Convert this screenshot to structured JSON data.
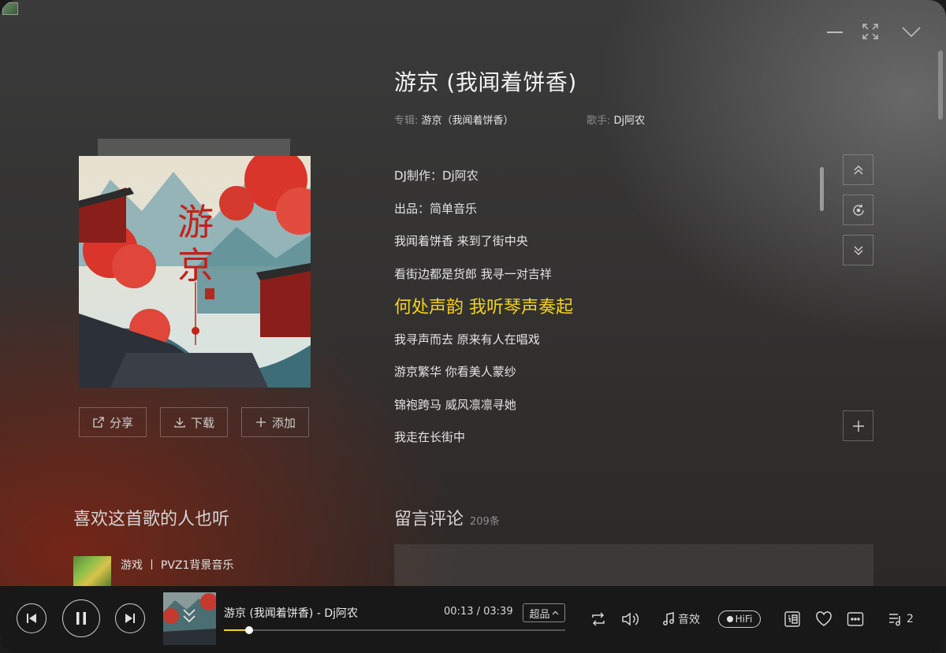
{
  "window": {
    "minimize_icon": "minimize-icon",
    "fullscreen_icon": "fullscreen-icon",
    "collapse_icon": "chevron-down-icon"
  },
  "song": {
    "title": "游京 (我闻着饼香)",
    "album_label": "专辑:",
    "album": "游京（我闻着饼香）",
    "artist_label": "歌手:",
    "artist": "Dj阿农"
  },
  "cover": {
    "title_char_1": "游",
    "title_char_2": "京"
  },
  "actions": {
    "share": "分享",
    "download": "下载",
    "add": "添加"
  },
  "lyrics": [
    {
      "text": "DJ制作：Dj阿农",
      "active": false
    },
    {
      "text": "出品：简单音乐",
      "active": false
    },
    {
      "text": "我闻着饼香 来到了街中央",
      "active": false
    },
    {
      "text": "看街边都是货郎 我寻一对吉祥",
      "active": false
    },
    {
      "text": "何处声韵 我听琴声奏起",
      "active": true
    },
    {
      "text": "我寻声而去 原来有人在唱戏",
      "active": false
    },
    {
      "text": "游京繁华 你看美人蒙纱",
      "active": false
    },
    {
      "text": "锦袍跨马 威风凛凛寻她",
      "active": false
    },
    {
      "text": "我走在长街中",
      "active": false
    }
  ],
  "similar": {
    "title": "喜欢这首歌的人也听",
    "item": "游戏 丨 PVZ1背景音乐"
  },
  "comments": {
    "title": "留言评论",
    "count": "209条"
  },
  "player": {
    "now_playing": "游京 (我闻着饼香) - Dj阿农",
    "elapsed": "00:13",
    "separator": " / ",
    "duration": "03:39",
    "quality": "超品",
    "progress": 0.074,
    "effects": "音效",
    "hifi": "HiFi",
    "queue_count": "2"
  },
  "colors": {
    "accent": "#f3d21a",
    "player_bg": "#181818"
  }
}
